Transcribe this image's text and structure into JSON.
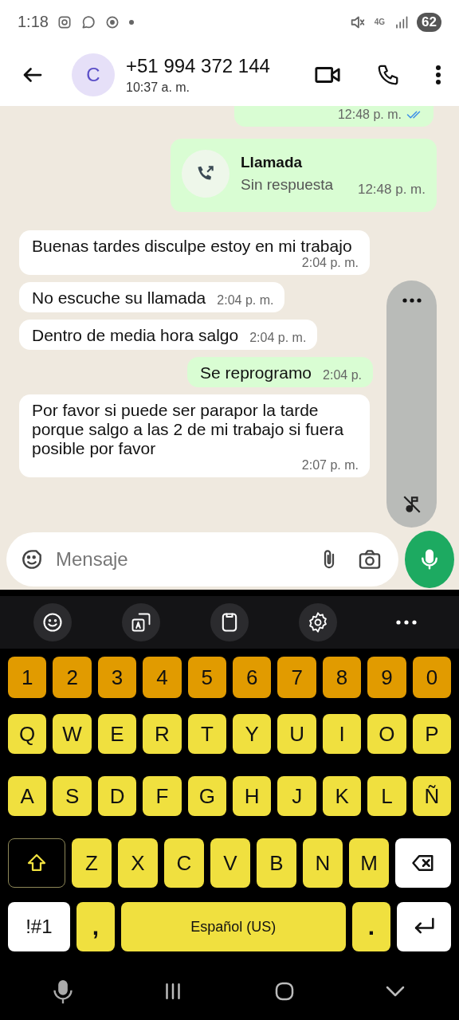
{
  "status_bar": {
    "time": "1:18",
    "battery": "62",
    "network": "4G"
  },
  "header": {
    "avatar_letter": "C",
    "contact": "+51 994 372 144",
    "last_seen": "10:37 a. m."
  },
  "messages": [
    {
      "kind": "outgoing",
      "time": "12:48 p. m.",
      "read": true
    },
    {
      "kind": "call",
      "title": "Llamada",
      "subtitle": "Sin respuesta",
      "time": "12:48 p. m."
    },
    {
      "kind": "incoming",
      "text": "Buenas tardes disculpe estoy en mi trabajo",
      "time": "2:04 p. m."
    },
    {
      "kind": "incoming",
      "text": "No escuche su llamada",
      "time": "2:04 p. m."
    },
    {
      "kind": "incoming",
      "text": "Dentro de media hora salgo",
      "time": "2:04 p. m."
    },
    {
      "kind": "outgoing",
      "text": "Se reprogramo",
      "time": "2:04 p."
    },
    {
      "kind": "incoming",
      "text": "Por favor si puede ser parapor la tarde porque salgo a las 2 de mi trabajo si fuera posible por favor",
      "time": "2:07 p. m."
    }
  ],
  "composer": {
    "placeholder": "Mensaje"
  },
  "keyboard": {
    "rows": [
      {
        "keys": [
          {
            "kind": "digit",
            "label": "1"
          },
          {
            "kind": "digit",
            "label": "2"
          },
          {
            "kind": "digit",
            "label": "3"
          },
          {
            "kind": "digit",
            "label": "4"
          },
          {
            "kind": "digit",
            "label": "5"
          },
          {
            "kind": "digit",
            "label": "6"
          },
          {
            "kind": "digit",
            "label": "7"
          },
          {
            "kind": "digit",
            "label": "8"
          },
          {
            "kind": "digit",
            "label": "9"
          },
          {
            "kind": "digit",
            "label": "0"
          }
        ]
      },
      {
        "keys": [
          {
            "kind": "letter",
            "label": "Q"
          },
          {
            "kind": "letter",
            "label": "W"
          },
          {
            "kind": "letter",
            "label": "E"
          },
          {
            "kind": "letter",
            "label": "R"
          },
          {
            "kind": "letter",
            "label": "T"
          },
          {
            "kind": "letter",
            "label": "Y"
          },
          {
            "kind": "letter",
            "label": "U"
          },
          {
            "kind": "letter",
            "label": "I"
          },
          {
            "kind": "letter",
            "label": "O"
          },
          {
            "kind": "letter",
            "label": "P"
          }
        ]
      },
      {
        "keys": [
          {
            "kind": "letter",
            "label": "A"
          },
          {
            "kind": "letter",
            "label": "S"
          },
          {
            "kind": "letter",
            "label": "D"
          },
          {
            "kind": "letter",
            "label": "F"
          },
          {
            "kind": "letter",
            "label": "G"
          },
          {
            "kind": "letter",
            "label": "H"
          },
          {
            "kind": "letter",
            "label": "J"
          },
          {
            "kind": "letter",
            "label": "K"
          },
          {
            "kind": "letter",
            "label": "L"
          },
          {
            "kind": "letter",
            "label": "Ñ"
          }
        ]
      },
      {
        "keys": [
          {
            "kind": "shift"
          },
          {
            "kind": "letter",
            "label": "Z"
          },
          {
            "kind": "letter",
            "label": "X"
          },
          {
            "kind": "letter",
            "label": "C"
          },
          {
            "kind": "letter",
            "label": "V"
          },
          {
            "kind": "letter",
            "label": "B"
          },
          {
            "kind": "letter",
            "label": "N"
          },
          {
            "kind": "letter",
            "label": "M"
          },
          {
            "kind": "backspace"
          }
        ]
      },
      {
        "keys": [
          {
            "kind": "symbols",
            "label": "!#1"
          },
          {
            "kind": "punct",
            "label": ","
          },
          {
            "kind": "space",
            "label": "Español (US)"
          },
          {
            "kind": "punct",
            "label": "."
          },
          {
            "kind": "enter"
          }
        ]
      }
    ]
  }
}
